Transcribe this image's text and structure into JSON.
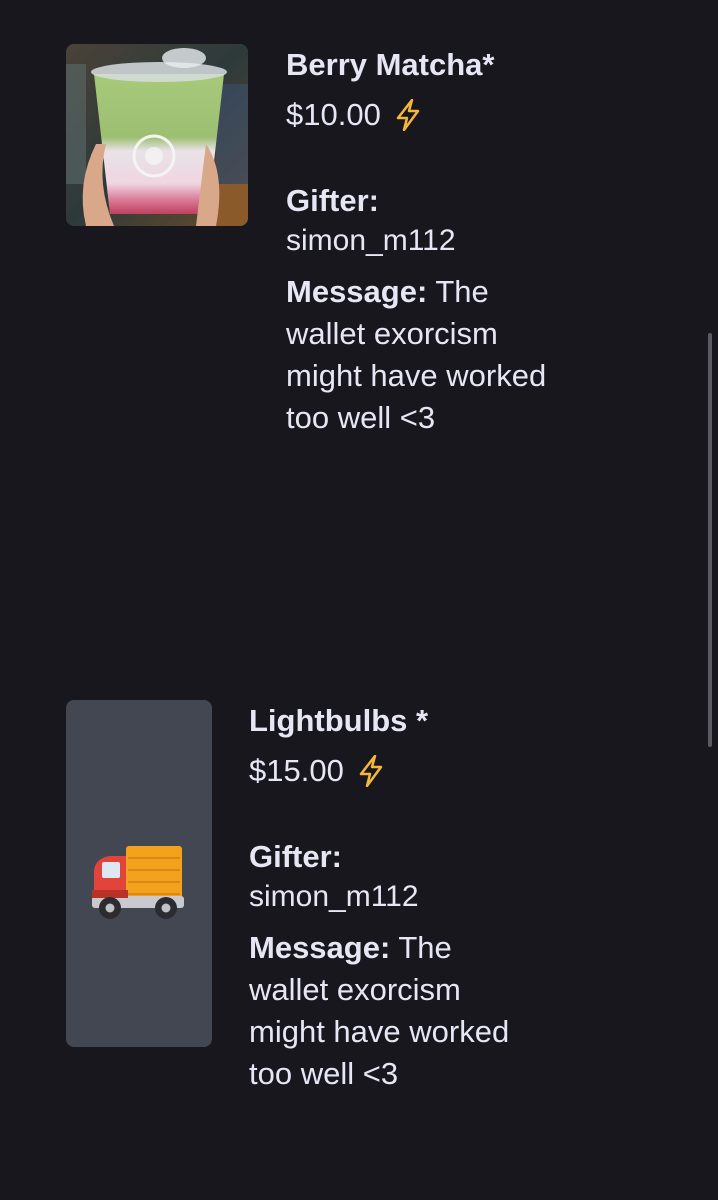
{
  "gifts": [
    {
      "title": "Berry Matcha*",
      "price": "$10.00",
      "gifter_label": "Gifter:",
      "gifter_name": "simon_m112",
      "message_label": "Message:",
      "message_text": " The wallet exorcism might have worked too well <3",
      "thumbnail": "matcha-drink-photo"
    },
    {
      "title": "Lightbulbs *",
      "price": "$15.00",
      "gifter_label": "Gifter:",
      "gifter_name": "simon_m112",
      "message_label": "Message:",
      "message_text": " The wallet exorcism might have worked too well <3",
      "thumbnail": "delivery-truck-emoji"
    }
  ],
  "colors": {
    "background": "#17171d",
    "text": "#e6e6f4",
    "bolt": "#f5b73b",
    "thumb_placeholder": "#434752"
  }
}
